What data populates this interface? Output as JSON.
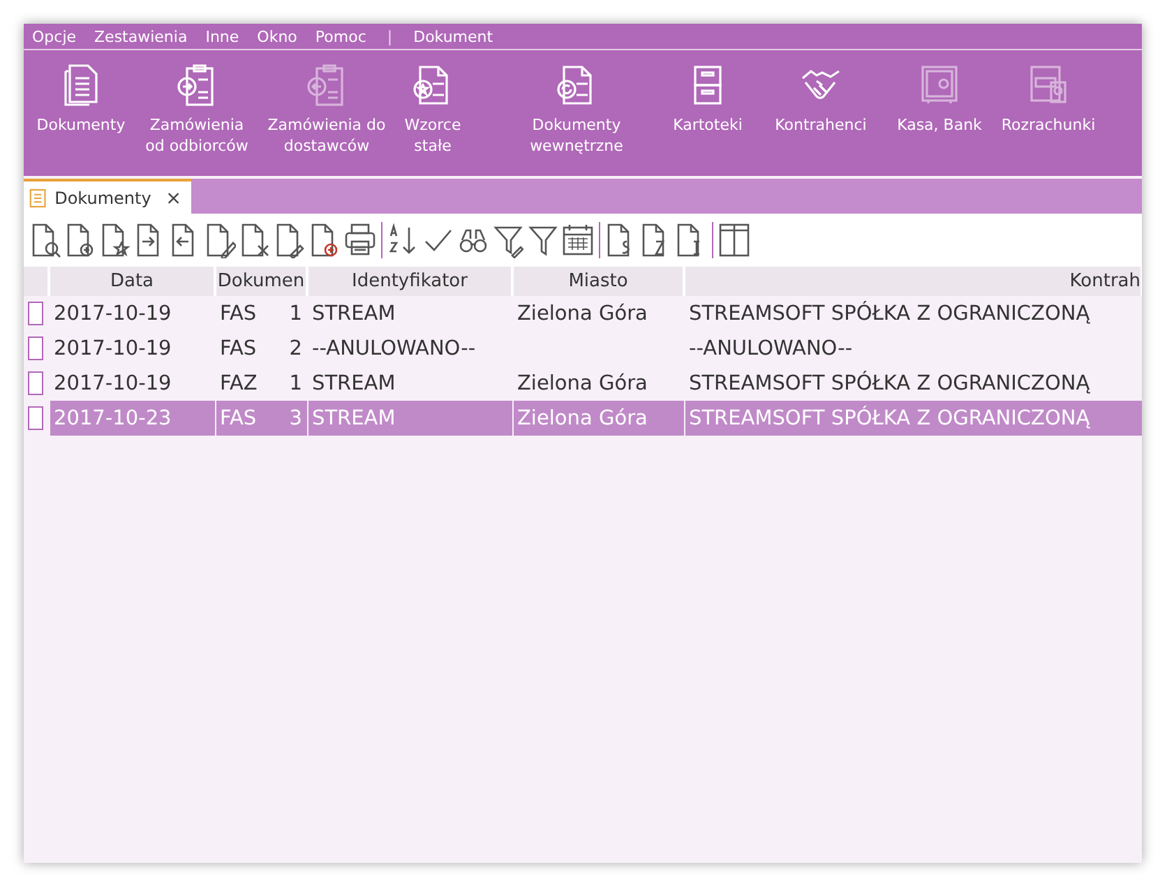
{
  "menu": [
    {
      "kind": "item",
      "label": "Opcje"
    },
    {
      "kind": "item",
      "label": "Zestawienia"
    },
    {
      "kind": "item",
      "label": "Inne"
    },
    {
      "kind": "item",
      "label": "Okno"
    },
    {
      "kind": "item",
      "label": "Pomoc"
    },
    {
      "kind": "separator",
      "label": "|"
    },
    {
      "kind": "item",
      "label": "Dokument"
    }
  ],
  "ribbon": [
    {
      "label": "Dokumenty",
      "disabled": false
    },
    {
      "label": "Zamówienia od odbiorców",
      "disabled": false
    },
    {
      "label": "Zamówienia do dostawców",
      "disabled": true
    },
    {
      "label": "Wzorce stałe",
      "disabled": false
    },
    {
      "label": "Dokumenty wewnętrzne",
      "disabled": false
    },
    {
      "label": "Kartoteki",
      "disabled": false
    },
    {
      "label": "Kontrahenci",
      "disabled": false
    },
    {
      "label": "Kasa, Bank",
      "disabled": true
    },
    {
      "label": "Rozrachunki",
      "disabled": true
    }
  ],
  "tabs": [
    {
      "label": "Dokumenty",
      "selected": true
    }
  ],
  "table": {
    "columns": [
      "Data",
      "Dokumen",
      "Identyfikator",
      "Miasto",
      "Kontrah"
    ],
    "rows": [
      {
        "date": "2017-10-19",
        "doc_type": "FAS",
        "doc_number": "1",
        "identifier": "STREAM",
        "city": "Zielona Góra",
        "contractor": "STREAMSOFT SPÓŁKA Z OGRANICZONĄ",
        "selected": false
      },
      {
        "date": "2017-10-19",
        "doc_type": "FAS",
        "doc_number": "2",
        "identifier": "--ANULOWANO--",
        "city": "",
        "contractor": "--ANULOWANO--",
        "selected": false
      },
      {
        "date": "2017-10-19",
        "doc_type": "FAZ",
        "doc_number": "1",
        "identifier": "STREAM",
        "city": "Zielona Góra",
        "contractor": "STREAMSOFT SPÓŁKA Z OGRANICZONĄ",
        "selected": false
      },
      {
        "date": "2017-10-23",
        "doc_type": "FAS",
        "doc_number": "3",
        "identifier": "STREAM",
        "city": "Zielona Góra",
        "contractor": "STREAMSOFT SPÓŁKA Z OGRANICZONĄ",
        "selected": true
      }
    ]
  }
}
